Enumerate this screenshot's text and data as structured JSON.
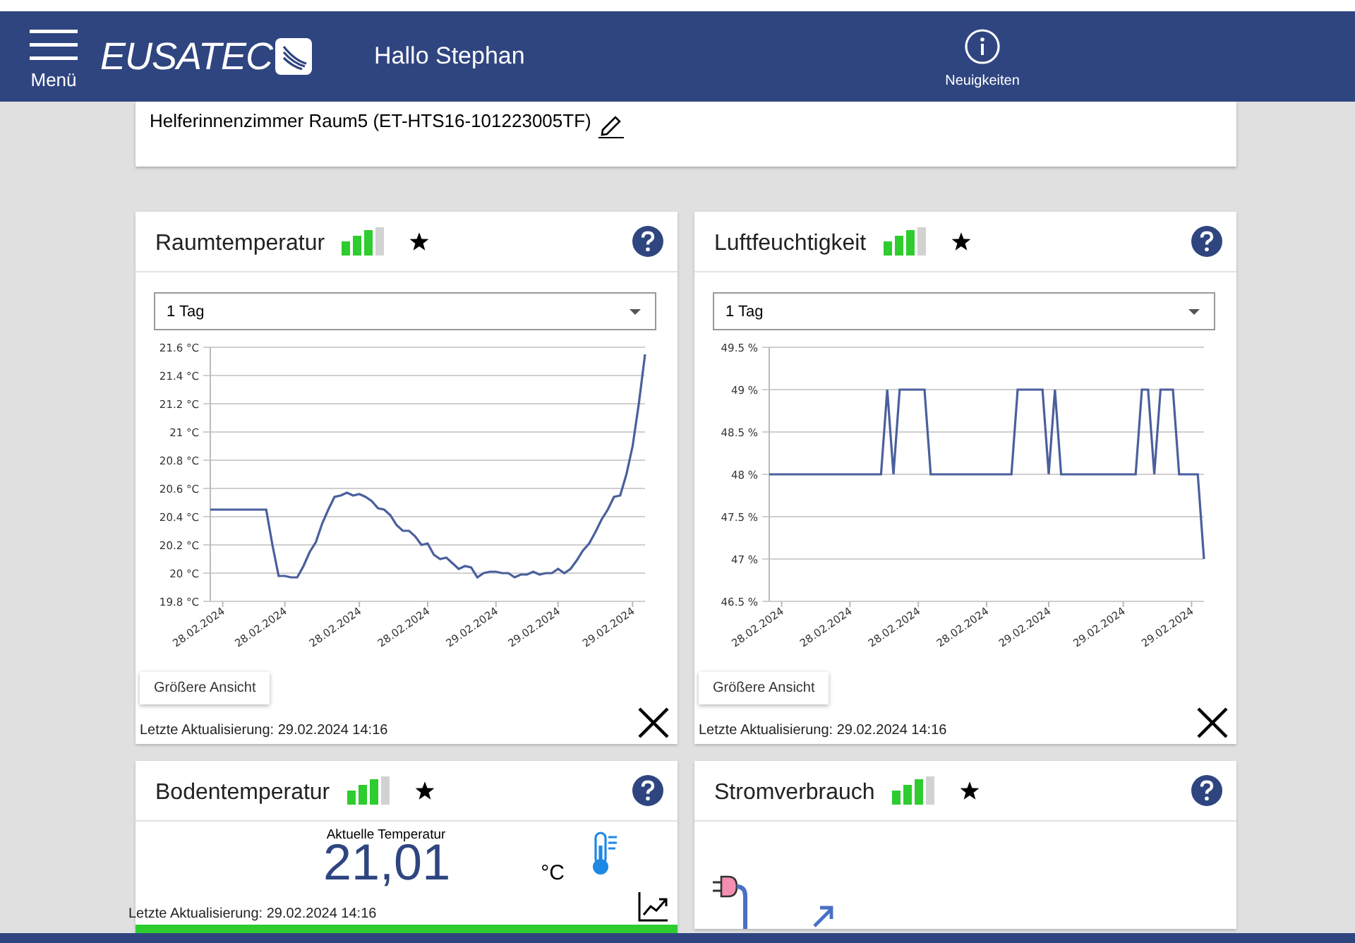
{
  "header": {
    "menu_label": "Menü",
    "logo": "EUSATEC",
    "greeting": "Hallo Stephan",
    "news_label": "Neuigkeiten"
  },
  "device": {
    "name": "Helferinnenzimmer Raum5 (ET-HTS16-101223005TF)"
  },
  "columns": [
    {
      "widgets": [
        {
          "kind": "chart",
          "title": "Raumtemperatur",
          "period": "1 Tag",
          "button": "Größere Ansicht",
          "last_update": "Letzte Aktualisierung: 29.02.2024 14:16",
          "chart_data": {
            "type": "line",
            "grid": true,
            "ylim": [
              19.8,
              21.6
            ],
            "yticks": [
              {
                "value": 19.8,
                "label": "19.8 °C"
              },
              {
                "value": 20,
                "label": "20 °C"
              },
              {
                "value": 20.2,
                "label": "20.2 °C"
              },
              {
                "value": 20.4,
                "label": "20.4 °C"
              },
              {
                "value": 20.6,
                "label": "20.6 °C"
              },
              {
                "value": 20.8,
                "label": "20.8 °C"
              },
              {
                "value": 21,
                "label": "21 °C"
              },
              {
                "value": 21.2,
                "label": "21.2 °C"
              },
              {
                "value": 21.4,
                "label": "21.4 °C"
              },
              {
                "value": 21.6,
                "label": "21.6 °C"
              }
            ],
            "categories": [
              null,
              null,
              "28.02.2024",
              null,
              null,
              null,
              null,
              null,
              null,
              null,
              null,
              null,
              "28.02.2024",
              null,
              null,
              null,
              null,
              null,
              null,
              null,
              null,
              null,
              null,
              null,
              "28.02.2024",
              null,
              null,
              null,
              null,
              null,
              null,
              null,
              null,
              null,
              null,
              "28.02.2024",
              null,
              null,
              null,
              null,
              null,
              null,
              null,
              null,
              null,
              null,
              "29.02.2024",
              null,
              null,
              null,
              null,
              null,
              null,
              null,
              null,
              null,
              "29.02.2024",
              null,
              null,
              null,
              null,
              null,
              null,
              null,
              null,
              null,
              null,
              null,
              "29.02.2024",
              null,
              null
            ],
            "series": [
              {
                "color": "#4a5f9c",
                "values": [
                  20.45,
                  20.45,
                  20.45,
                  20.45,
                  20.45,
                  20.45,
                  20.45,
                  20.45,
                  20.45,
                  20.45,
                  20.2,
                  19.98,
                  19.98,
                  19.97,
                  19.97,
                  20.05,
                  20.15,
                  20.22,
                  20.35,
                  20.45,
                  20.54,
                  20.55,
                  20.57,
                  20.55,
                  20.56,
                  20.54,
                  20.51,
                  20.46,
                  20.45,
                  20.41,
                  20.34,
                  20.3,
                  20.3,
                  20.26,
                  20.2,
                  20.21,
                  20.13,
                  20.1,
                  20.11,
                  20.07,
                  20.03,
                  20.05,
                  20.04,
                  19.97,
                  20.0,
                  20.01,
                  20.01,
                  20.0,
                  20.0,
                  19.97,
                  19.99,
                  19.99,
                  20.01,
                  19.99,
                  20.0,
                  20.0,
                  20.03,
                  20.0,
                  20.03,
                  20.09,
                  20.16,
                  20.21,
                  20.29,
                  20.38,
                  20.45,
                  20.54,
                  20.55,
                  20.7,
                  20.9,
                  21.2,
                  21.55
                ]
              }
            ]
          }
        },
        {
          "kind": "current",
          "title": "Bodentemperatur",
          "caption": "Aktuelle Temperatur",
          "value": "21,01",
          "unit": "°C",
          "last_update": "Letzte Aktualisierung: 29.02.2024 14:16"
        }
      ]
    },
    {
      "widgets": [
        {
          "kind": "chart",
          "title": "Luftfeuchtigkeit",
          "period": "1 Tag",
          "button": "Größere Ansicht",
          "last_update": "Letzte Aktualisierung: 29.02.2024 14:16",
          "chart_data": {
            "type": "line",
            "grid": true,
            "ylim": [
              46.5,
              49.5
            ],
            "yticks": [
              {
                "value": 46.5,
                "label": "46.5 %"
              },
              {
                "value": 47,
                "label": "47 %"
              },
              {
                "value": 47.5,
                "label": "47.5 %"
              },
              {
                "value": 48,
                "label": "48 %"
              },
              {
                "value": 48.5,
                "label": "48.5 %"
              },
              {
                "value": 49,
                "label": "49 %"
              },
              {
                "value": 49.5,
                "label": "49.5 %"
              }
            ],
            "categories": [
              null,
              null,
              "28.02.2024",
              null,
              null,
              null,
              null,
              null,
              null,
              null,
              null,
              null,
              null,
              "28.02.2024",
              null,
              null,
              null,
              null,
              null,
              null,
              null,
              null,
              null,
              null,
              "28.02.2024",
              null,
              null,
              null,
              null,
              null,
              null,
              null,
              null,
              null,
              null,
              "28.02.2024",
              null,
              null,
              null,
              null,
              null,
              null,
              null,
              null,
              null,
              "29.02.2024",
              null,
              null,
              null,
              null,
              null,
              null,
              null,
              null,
              null,
              null,
              null,
              "29.02.2024",
              null,
              null,
              null,
              null,
              null,
              null,
              null,
              null,
              null,
              null,
              "29.02.2024",
              null,
              null
            ],
            "series": [
              {
                "color": "#4a5f9c",
                "values": [
                  48,
                  48,
                  48,
                  48,
                  48,
                  48,
                  48,
                  48,
                  48,
                  48,
                  48,
                  48,
                  48,
                  48,
                  48,
                  48,
                  48,
                  48,
                  48,
                  49,
                  48,
                  49,
                  49,
                  49,
                  49,
                  49,
                  48,
                  48,
                  48,
                  48,
                  48,
                  48,
                  48,
                  48,
                  48,
                  48,
                  48,
                  48,
                  48,
                  48,
                  49,
                  49,
                  49,
                  49,
                  49,
                  48,
                  49,
                  48,
                  48,
                  48,
                  48,
                  48,
                  48,
                  48,
                  48,
                  48,
                  48,
                  48,
                  48,
                  48,
                  49,
                  49,
                  48,
                  49,
                  49,
                  49,
                  48,
                  48,
                  48,
                  48,
                  47
                ]
              }
            ]
          }
        },
        {
          "kind": "power",
          "title": "Stromverbrauch"
        }
      ]
    }
  ]
}
